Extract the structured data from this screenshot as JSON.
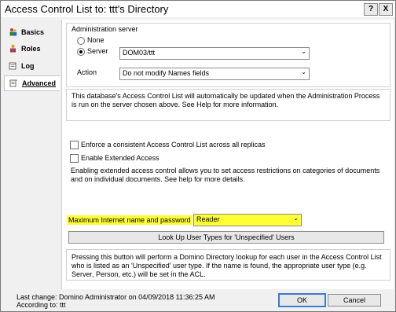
{
  "window": {
    "title": "Access Control List to: ttt's Directory",
    "help_glyph": "?",
    "close_glyph": "X"
  },
  "sidebar": {
    "items": [
      {
        "label": "Basics",
        "icon": "people-icon"
      },
      {
        "label": "Roles",
        "icon": "roles-icon"
      },
      {
        "label": "Log",
        "icon": "log-icon"
      },
      {
        "label": "Advanced",
        "icon": "advanced-icon"
      }
    ],
    "active": "Advanced"
  },
  "admin_server": {
    "group_label": "Administration server",
    "none_label": "None",
    "server_label": "Server",
    "server_selected": true,
    "server_value": "DOM03/ttt",
    "action_label": "Action",
    "action_value": "Do not modify Names fields"
  },
  "info_text": "This database's Access Control List will automatically be updated when the Administration Process is run on the server chosen above. See Help for more information.",
  "enforce_label": "Enforce a consistent Access Control List across all replicas",
  "extended_label": "Enable Extended Access",
  "extended_text": "Enabling extended access control allows you to set access restrictions on categories of documents and on individual documents. See help for more details.",
  "internet": {
    "label": "Maximum Internet name and password",
    "value": "Reader",
    "highlight_color": "#ffff33"
  },
  "lookup_button": "Look Up User Types for 'Unspecified' Users",
  "lookup_text": "Pressing this button will perform a Domino Directory lookup for each user in the Access Control List who is listed as an 'Unspecified' user type.  If the name is found, the appropriate user type (e.g. Server, Person, etc.) will be set in the ACL.",
  "footer": {
    "last_change": "Last change: Domino Administrator on 04/09/2018 11:36:25 AM",
    "according_to": "According to: ttt",
    "ok_label": "OK",
    "cancel_label": "Cancel"
  }
}
